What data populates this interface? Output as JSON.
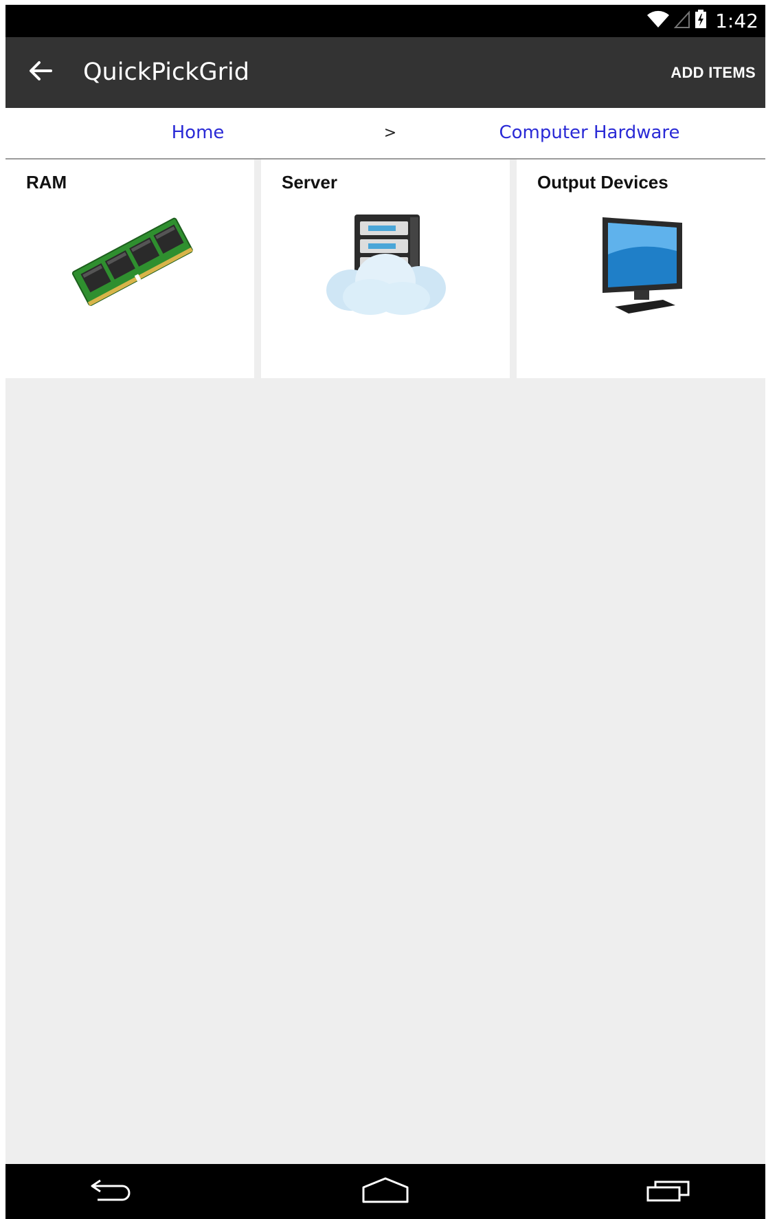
{
  "status_bar": {
    "time": "1:42",
    "icons": [
      "wifi-icon",
      "signal-icon",
      "battery-charging-icon"
    ]
  },
  "action_bar": {
    "title": "QuickPickGrid",
    "back_icon": "arrow-back-icon",
    "action_label": "ADD ITEMS"
  },
  "breadcrumb": {
    "home": "Home",
    "separator": ">",
    "current": "Computer Hardware"
  },
  "grid": {
    "items": [
      {
        "label": "RAM",
        "icon": "ram-module-image"
      },
      {
        "label": "Server",
        "icon": "cloud-server-image"
      },
      {
        "label": "Output Devices",
        "icon": "monitor-image"
      }
    ]
  },
  "nav_bar": {
    "buttons": [
      "back-nav-icon",
      "home-nav-icon",
      "recent-apps-icon"
    ]
  },
  "colors": {
    "action_bar": "#333333",
    "link": "#2a2ad6",
    "background": "#eeeeee",
    "status_bar": "#000000"
  }
}
